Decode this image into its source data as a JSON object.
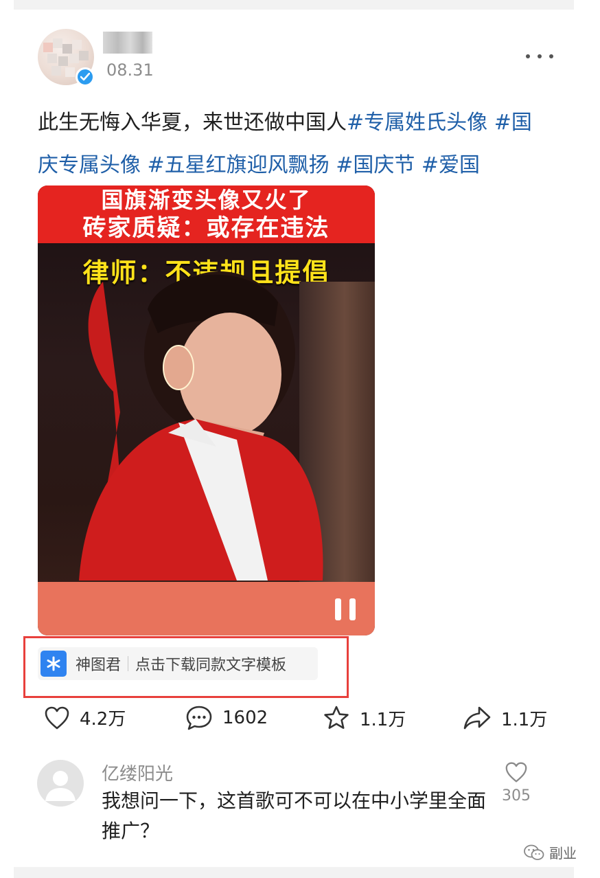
{
  "post": {
    "date": "08.31",
    "text": "此生无悔入华夏，来世还做中国人",
    "tags": [
      "#专属姓氏头像",
      "#国庆专属头像",
      "#五星红旗迎风飘扬",
      "#国庆节",
      "#爱国"
    ]
  },
  "video": {
    "headline_line1": "国旗渐变头像又火了",
    "headline_line2": "砖家质疑：或存在违法",
    "headline_line3": "律师：不违规且提倡",
    "state_icon": "pause-icon"
  },
  "template_chip": {
    "source": "神图君",
    "action": "点击下载同款文字模板",
    "logo_icon": "asterisk-logo-icon"
  },
  "actions": {
    "likes": "4.2万",
    "comments": "1602",
    "favorites": "1.1万",
    "shares": "1.1万"
  },
  "comment": {
    "username": "亿缕阳光",
    "text": "我想问一下，这首歌可不可以在中小学里全面推广？",
    "like_count": "305"
  },
  "watermark": {
    "text": "副业"
  },
  "colors": {
    "tag_blue": "#1f5fa8",
    "verified_blue": "#2c9cf0",
    "highlight_red": "#e8403c",
    "video_red": "#e52420",
    "headline_yellow": "#ffe21a",
    "chip_logo_blue": "#2f83f0"
  }
}
